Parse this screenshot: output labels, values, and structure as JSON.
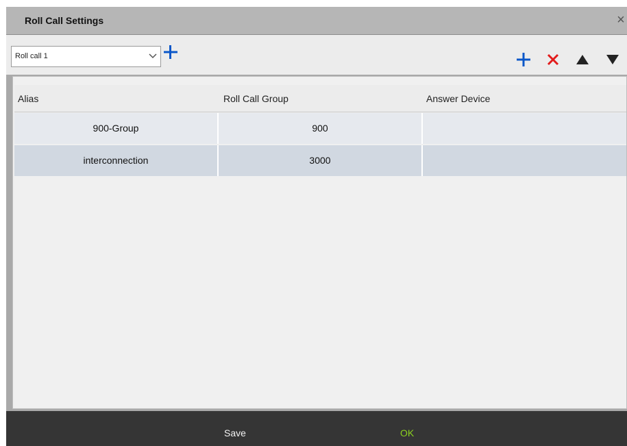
{
  "window": {
    "title": "Roll Call Settings",
    "close_glyph": "×"
  },
  "toolbar": {
    "select_value": "Roll call 1"
  },
  "colors": {
    "add": "#0b57c9",
    "delete": "#e21b1b",
    "move": "#222222",
    "ok_text": "#8bd21f",
    "save_text": "#f2f2f2"
  },
  "icons": {
    "add_group": "plus-icon",
    "add_row": "plus-icon",
    "delete_row": "close-icon",
    "move_up": "triangle-up-icon",
    "move_down": "triangle-down-icon",
    "dropdown": "chevron-down-icon"
  },
  "table": {
    "headers": [
      "Alias",
      "Roll Call Group",
      "Answer Device"
    ],
    "rows": [
      [
        "900-Group",
        "900",
        ""
      ],
      [
        "interconnection",
        "3000",
        ""
      ]
    ]
  },
  "footer": {
    "save_label": "Save",
    "ok_label": "OK"
  }
}
